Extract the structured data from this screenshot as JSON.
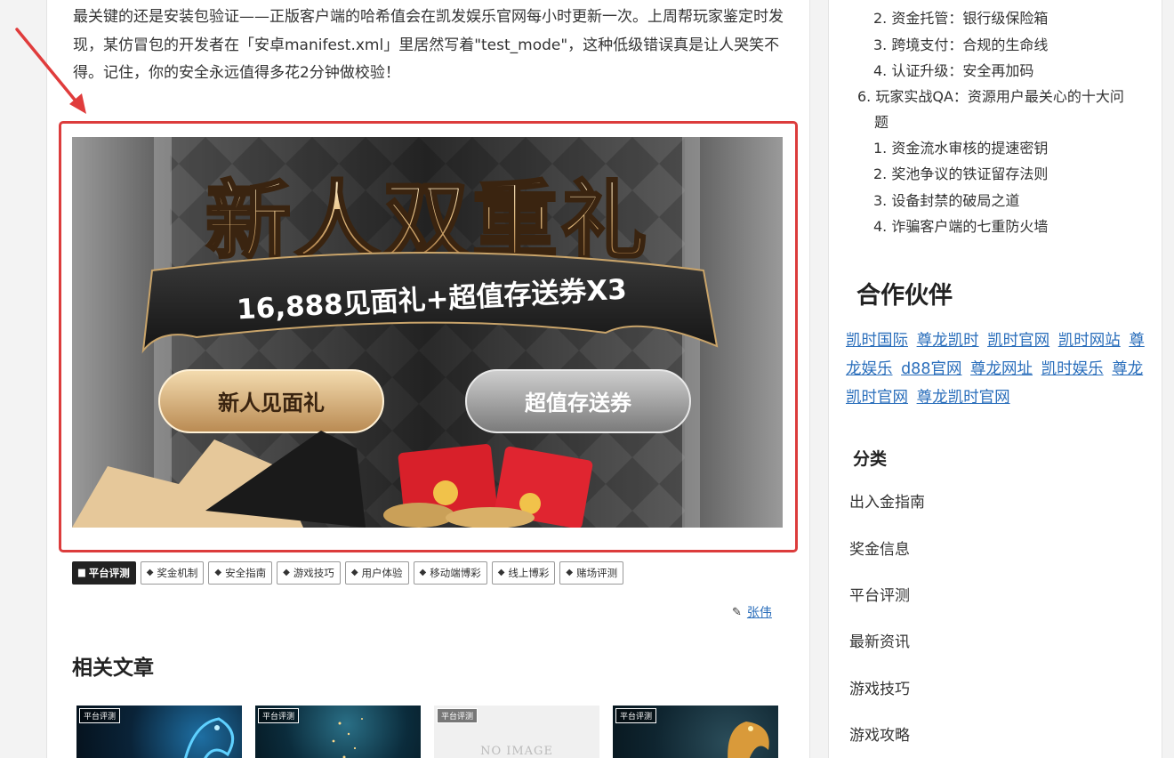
{
  "article": {
    "paragraph": "最关键的还是安装包验证——正版客户端的哈希值会在凯发娱乐官网每小时更新一次。上周帮玩家鉴定时发现，某仿冒包的开发者在「安卓manifest.xml」里居然写着\"test_mode\"，这种低级错误真是让人哭笑不得。记住，你的安全永远值得多花2分钟做校验！",
    "banner": {
      "title": "新人双重礼",
      "subtitle": "16,888见面礼+超值存送券X3",
      "btn_left": "新人见面礼",
      "btn_right": "超值存送券"
    },
    "tags": [
      {
        "label": "平台评测",
        "icon": "folder-icon",
        "primary": true
      },
      {
        "label": "奖金机制",
        "icon": "tag-icon"
      },
      {
        "label": "安全指南",
        "icon": "tag-icon"
      },
      {
        "label": "游戏技巧",
        "icon": "tag-icon"
      },
      {
        "label": "用户体验",
        "icon": "tag-icon"
      },
      {
        "label": "移动端博彩",
        "icon": "tag-icon"
      },
      {
        "label": "线上博彩",
        "icon": "tag-icon"
      },
      {
        "label": "赌场评测",
        "icon": "tag-icon"
      }
    ],
    "author": "张伟",
    "related_title": "相关文章",
    "related": [
      {
        "label": "平台评测",
        "image": "blue-dragon"
      },
      {
        "label": "平台评测",
        "image": "blue-sparkles"
      },
      {
        "label": "平台评测",
        "image": "no-image",
        "placeholder": "NO IMAGE"
      },
      {
        "label": "平台评测",
        "image": "gold-dragon"
      }
    ]
  },
  "sidebar": {
    "toc": [
      "2. 资金托管：银行级保险箱",
      "3. 跨境支付：合规的生命线",
      "4. 认证升级：安全再加码",
      "6. 玩家实战QA：资源用户最关心的十大问",
      "题",
      "1. 资金流水审核的提速密钥",
      "2. 奖池争议的铁证留存法则",
      "3. 设备封禁的破局之道",
      "4. 诈骗客户端的七重防火墙"
    ],
    "partners_title": "合作伙伴",
    "partners": [
      "凯时国际",
      "尊龙凯时",
      "凯时官网",
      "凯时网站",
      "尊龙娱乐",
      "d88官网",
      "尊龙网址",
      "凯时娱乐",
      "尊龙凯时官网",
      "尊龙凯时官网"
    ],
    "categories_title": "分类",
    "categories": [
      "出入金指南",
      "奖金信息",
      "平台评测",
      "最新资讯",
      "游戏技巧",
      "游戏攻略"
    ]
  },
  "colors": {
    "highlight_border": "#dc3c3c",
    "link": "#2a6ebb",
    "arrow": "#e03c3c"
  }
}
